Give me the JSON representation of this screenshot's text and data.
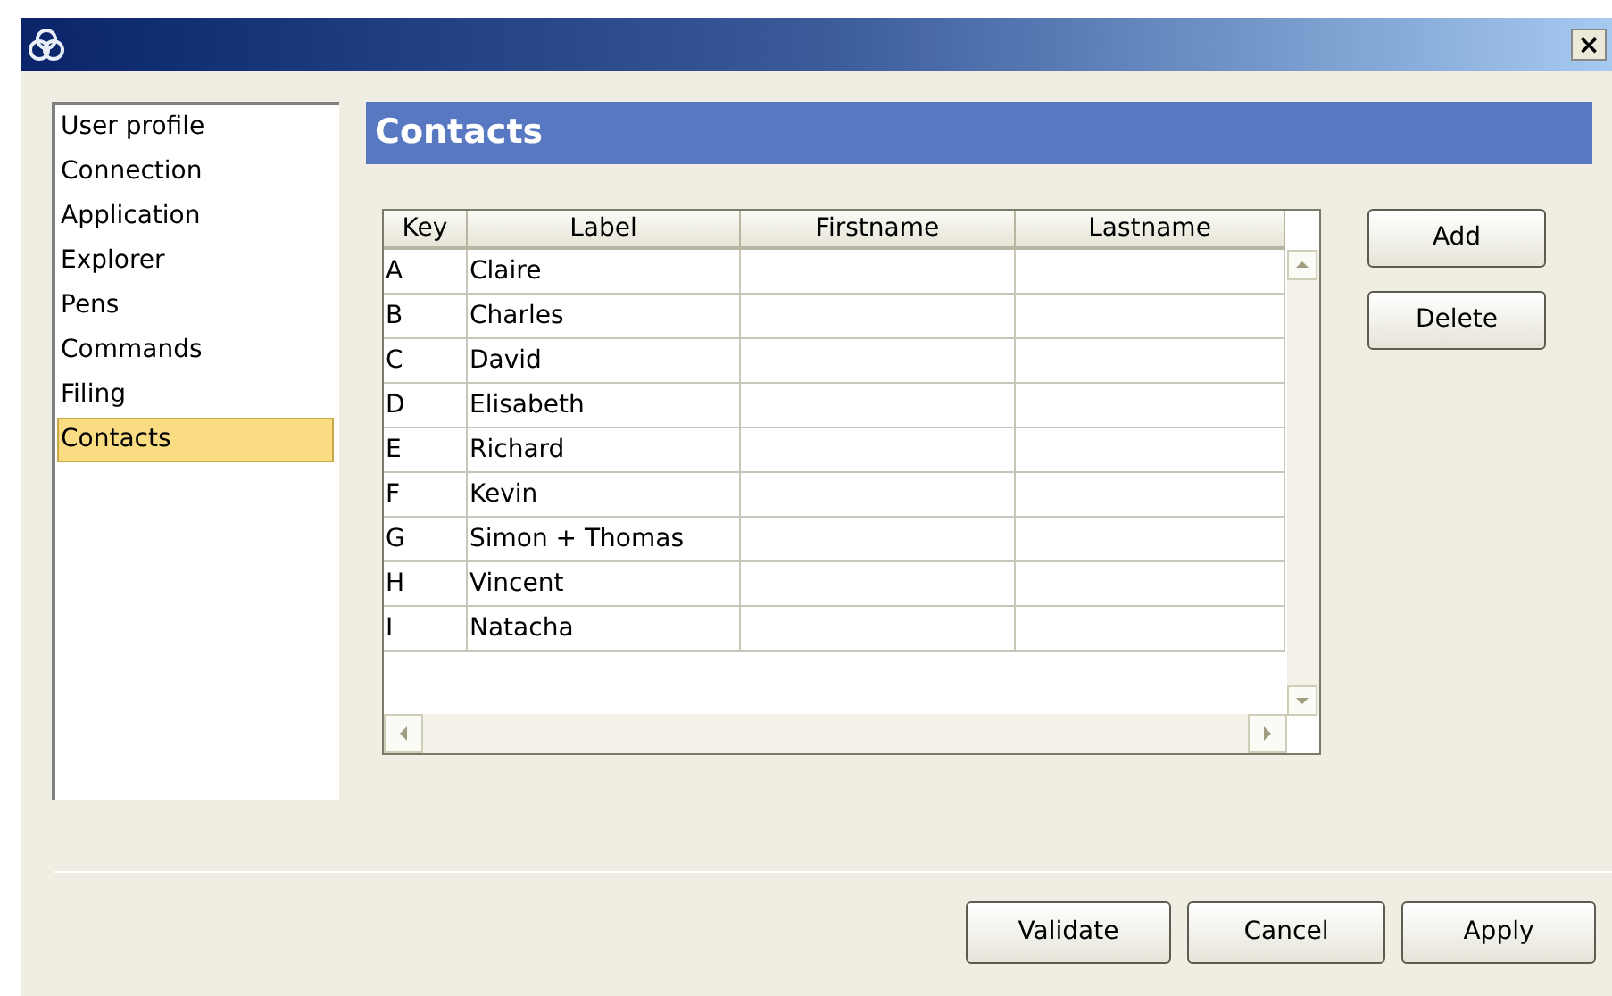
{
  "window": {
    "close": "×"
  },
  "sidebar": {
    "items": [
      {
        "label": "User profile",
        "selected": false
      },
      {
        "label": "Connection",
        "selected": false
      },
      {
        "label": "Application",
        "selected": false
      },
      {
        "label": "Explorer",
        "selected": false
      },
      {
        "label": "Pens",
        "selected": false
      },
      {
        "label": "Commands",
        "selected": false
      },
      {
        "label": "Filing",
        "selected": false
      },
      {
        "label": "Contacts",
        "selected": true
      }
    ]
  },
  "panel": {
    "title": "Contacts"
  },
  "table": {
    "columns": [
      "Key",
      "Label",
      "Firstname",
      "Lastname"
    ],
    "rows": [
      {
        "key": "A",
        "label": "Claire"
      },
      {
        "key": "B",
        "label": "Charles"
      },
      {
        "key": "C",
        "label": "David"
      },
      {
        "key": "D",
        "label": "Elisabeth"
      },
      {
        "key": "E",
        "label": "Richard"
      },
      {
        "key": "F",
        "label": "Kevin"
      },
      {
        "key": "G",
        "label": "Simon + Thomas"
      },
      {
        "key": "H",
        "label": "Vincent"
      },
      {
        "key": "I",
        "label": "Natacha"
      }
    ]
  },
  "side_buttons": [
    "Add",
    "Delete"
  ],
  "footer_buttons": [
    "Validate",
    "Cancel",
    "Apply"
  ]
}
